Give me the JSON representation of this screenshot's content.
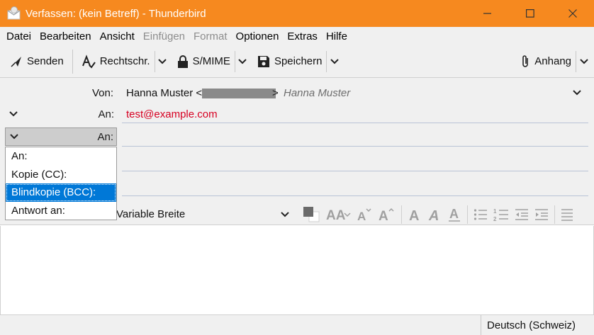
{
  "window": {
    "title": "Verfassen: (kein Betreff) - Thunderbird",
    "controls": [
      "minimize-icon",
      "maximize-icon",
      "close-icon"
    ]
  },
  "menu": [
    {
      "label": "Datei",
      "enabled": true
    },
    {
      "label": "Bearbeiten",
      "enabled": true
    },
    {
      "label": "Ansicht",
      "enabled": true
    },
    {
      "label": "Einfügen",
      "enabled": false
    },
    {
      "label": "Format",
      "enabled": false
    },
    {
      "label": "Optionen",
      "enabled": true
    },
    {
      "label": "Extras",
      "enabled": true
    },
    {
      "label": "Hilfe",
      "enabled": true
    }
  ],
  "toolbar": {
    "send_label": "Senden",
    "spelling_label": "Rechtschr.",
    "smime_label": "S/MIME",
    "save_label": "Speichern",
    "attach_label": "Anhang"
  },
  "header": {
    "from_label": "Von:",
    "from_name": "Hanna Muster <",
    "from_suffix": ">",
    "from_identity": "Hanna Muster",
    "to_label": "An:",
    "to_recipient": "test@example.com",
    "second_type_label": "An:"
  },
  "address_type_menu": {
    "options": [
      "An:",
      "Kopie (CC):",
      "Blindkopie (BCC):",
      "Antwort an:"
    ],
    "selected_index": 2
  },
  "format": {
    "font": "Variable Breite"
  },
  "status": {
    "language": "Deutsch (Schweiz)"
  },
  "colors": {
    "titlebar": "#f6891f",
    "recipient": "#d70022",
    "selection": "#0078d7"
  }
}
